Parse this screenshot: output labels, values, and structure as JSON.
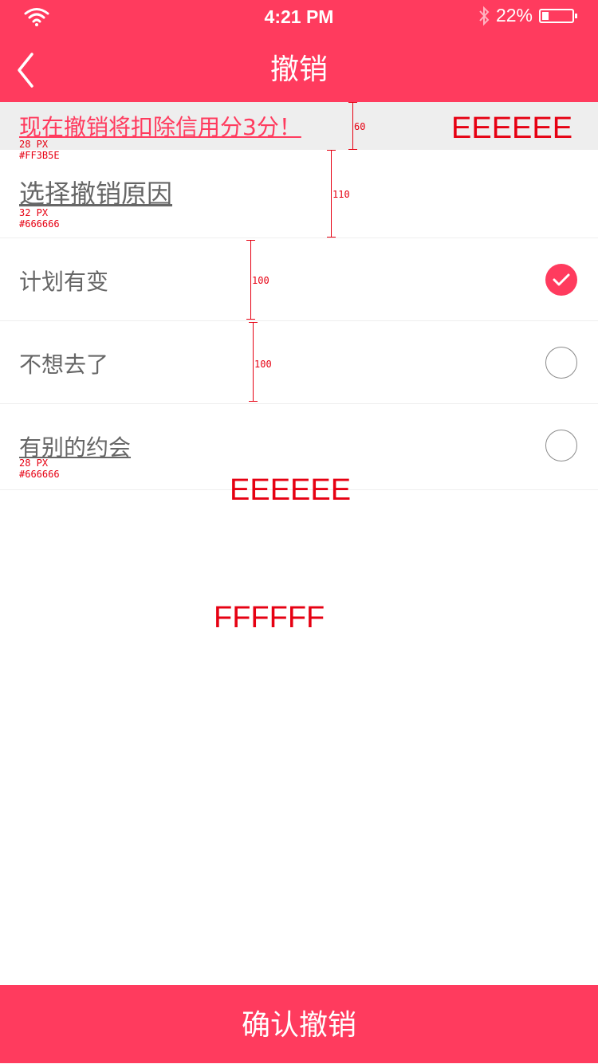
{
  "status_bar": {
    "time": "4:21 PM",
    "battery_percent": "22%",
    "battery_level": 0.22
  },
  "nav": {
    "title": "撤销"
  },
  "warning": {
    "text": "现在撤销将扣除信用分3分！",
    "spec_size": "28 PX",
    "spec_color": "#FF3B5E"
  },
  "section": {
    "title": "选择撤销原因",
    "spec_size": "32 PX",
    "spec_color": "#666666"
  },
  "options": [
    {
      "label": "计划有变",
      "checked": true
    },
    {
      "label": "不想去了",
      "checked": false
    },
    {
      "label": "有别的约会",
      "checked": false
    }
  ],
  "option_spec": {
    "size": "28 PX",
    "color": "#666666"
  },
  "annotations": {
    "warning_bg_color": "EEEEEE",
    "divider_color": "EEEEEE",
    "page_bg_color": "FFFFFF",
    "height_60": "60",
    "height_110": "110",
    "height_100_a": "100",
    "height_100_b": "100"
  },
  "footer": {
    "confirm_label": "确认撤销"
  },
  "colors": {
    "accent": "#FF3B5E",
    "text_gray": "#666666",
    "divider": "#EEEEEE",
    "annotation": "#E60012"
  }
}
